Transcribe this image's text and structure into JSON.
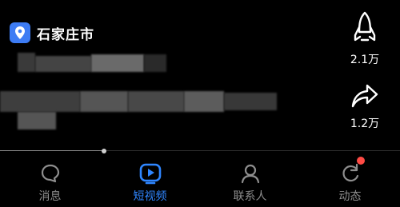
{
  "location": {
    "label": "石家庄市",
    "icon": "map-pin-icon"
  },
  "side_actions": [
    {
      "icon": "rocket-icon",
      "count": "2.1万"
    },
    {
      "icon": "share-arrow-icon",
      "count": "1.2万"
    }
  ],
  "progress": {
    "fraction": 0.26
  },
  "tabs": [
    {
      "label": "消息",
      "icon": "message-icon",
      "active": false
    },
    {
      "label": "短视频",
      "icon": "video-icon",
      "active": true
    },
    {
      "label": "联系人",
      "icon": "contacts-icon",
      "active": false
    },
    {
      "label": "动态",
      "icon": "refresh-activity-icon",
      "active": false,
      "badge": true
    }
  ],
  "colors": {
    "accent": "#2f86ff",
    "badge": "#ff4b45",
    "location_chip": "#3d7cf4"
  }
}
